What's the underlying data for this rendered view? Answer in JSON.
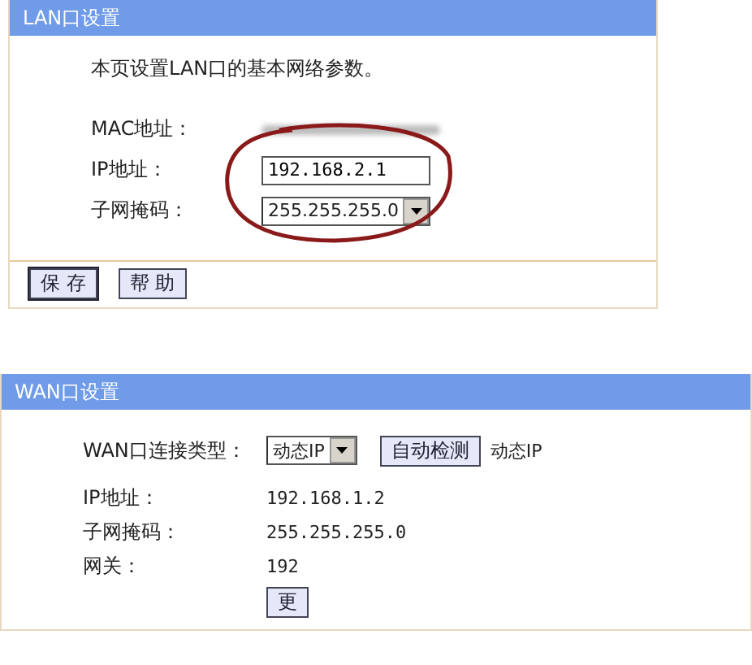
{
  "lan": {
    "title": "LAN口设置",
    "intro": "本页设置LAN口的基本网络参数。",
    "mac": {
      "label": "MAC地址："
    },
    "ip": {
      "label": "IP地址：",
      "value": "192.168.2.1"
    },
    "mask": {
      "label": "子网掩码：",
      "value": "255.255.255.0"
    },
    "buttons": [
      {
        "label": "保 存",
        "selected": true
      },
      {
        "label": "帮 助",
        "selected": false
      }
    ]
  },
  "wan": {
    "title": "WAN口设置",
    "type": {
      "label": "WAN口连接类型：",
      "value": "动态IP",
      "detect": "自动检测",
      "status": "动态IP"
    },
    "rows": [
      {
        "label": "IP地址：",
        "value": "192.168.1.2"
      },
      {
        "label": "子网掩码：",
        "value": "255.255.255.0"
      },
      {
        "label": "网关：",
        "value": "192"
      }
    ],
    "button": "更"
  }
}
